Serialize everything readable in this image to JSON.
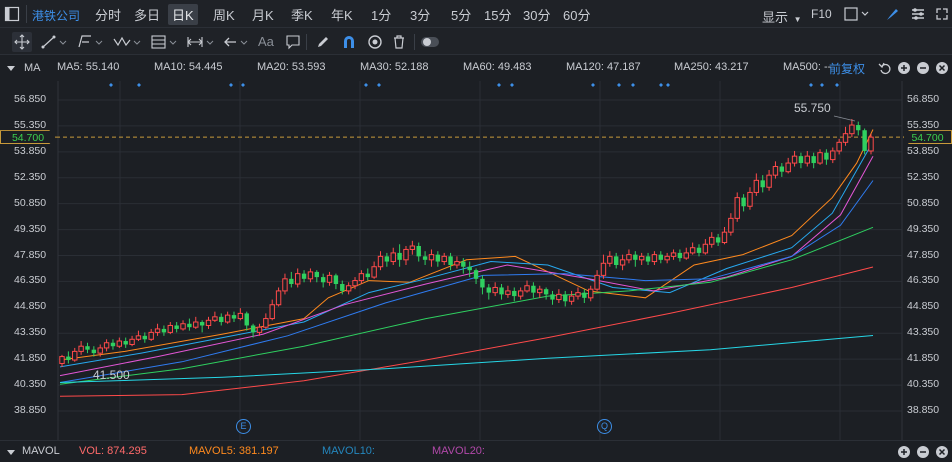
{
  "toolbar": {
    "stock_name": "港铁公司",
    "timeframes": [
      "分时",
      "多日",
      "日K",
      "周K",
      "月K",
      "季K",
      "年K",
      "1分",
      "3分",
      "5分",
      "15分",
      "30分",
      "60分"
    ],
    "active_timeframe": "日K",
    "display_label": "显示",
    "f10_label": "F10"
  },
  "drawing_tools": {
    "icons": [
      "crosshair-icon",
      "line-tool-icon",
      "channel-tool-icon",
      "wave-tool-icon",
      "fib-tool-icon",
      "range-tool-icon",
      "arrow-tool-icon",
      "text-tool-icon",
      "note-tool-icon",
      "pen-icon",
      "magnet-icon",
      "eye-icon",
      "trash-icon",
      "toggle-icon"
    ],
    "text_tool_label": "Aa"
  },
  "ma_bar": {
    "label": "MA",
    "items": [
      {
        "text": "MA5: 55.140",
        "color": "#ff8a1e"
      },
      {
        "text": "MA10: 54.445",
        "color": "#27a9f0"
      },
      {
        "text": "MA20: 53.593",
        "color": "#e356d6"
      },
      {
        "text": "MA30: 52.188",
        "color": "#2f7bf0"
      },
      {
        "text": "MA60: 49.483",
        "color": "#2fd060"
      },
      {
        "text": "MA120: 47.187",
        "color": "#ff4a4a"
      },
      {
        "text": "MA250: 43.217",
        "color": "#26d6e6"
      },
      {
        "text": "MA500: --",
        "color": "#8a7a3a"
      }
    ],
    "adjust_label": "前复权"
  },
  "price_axis": {
    "ticks": [
      "56.850",
      "55.350",
      "53.850",
      "52.350",
      "50.850",
      "49.350",
      "47.850",
      "46.350",
      "44.850",
      "43.350",
      "41.850",
      "40.350",
      "38.850"
    ],
    "current_price": "54.700",
    "high_label": "55.750",
    "low_label": "41.500"
  },
  "markers": {
    "event_e": "E",
    "event_q": "Q"
  },
  "volume_bar": {
    "label": "MAVOL",
    "vol": "VOL: 874.295",
    "mavol5": "MAVOL5: 381.197",
    "mavol10": "MAVOL10:",
    "mavol20": "MAVOL20:"
  },
  "colors": {
    "up": "#ff4a4a",
    "down": "#2fd060",
    "current": "#3ccf4e",
    "accent": "#3d8fe8"
  },
  "chart_data": {
    "type": "candlestick",
    "ylim": [
      38.25,
      57.45
    ],
    "candles": [
      [
        41.6,
        42.0,
        42.1,
        41.4
      ],
      [
        42.0,
        41.8,
        42.3,
        41.6
      ],
      [
        41.8,
        42.3,
        42.5,
        41.7
      ],
      [
        42.3,
        42.6,
        42.9,
        42.1
      ],
      [
        42.6,
        42.4,
        42.8,
        42.2
      ],
      [
        42.4,
        42.2,
        42.6,
        42.0
      ],
      [
        42.2,
        42.5,
        42.7,
        42.0
      ],
      [
        42.5,
        42.8,
        43.0,
        42.3
      ],
      [
        42.8,
        42.6,
        43.0,
        42.4
      ],
      [
        42.6,
        42.9,
        43.1,
        42.5
      ],
      [
        42.9,
        42.7,
        43.1,
        42.5
      ],
      [
        42.7,
        43.0,
        43.2,
        42.6
      ],
      [
        43.0,
        43.2,
        43.5,
        42.9
      ],
      [
        43.2,
        43.0,
        43.4,
        42.8
      ],
      [
        43.0,
        43.4,
        43.6,
        42.9
      ],
      [
        43.4,
        43.6,
        43.9,
        43.2
      ],
      [
        43.6,
        43.4,
        43.8,
        43.2
      ],
      [
        43.4,
        43.8,
        44.0,
        43.3
      ],
      [
        43.8,
        43.6,
        44.0,
        43.4
      ],
      [
        43.6,
        43.9,
        44.1,
        43.5
      ],
      [
        43.9,
        43.7,
        44.2,
        43.5
      ],
      [
        43.7,
        44.0,
        44.3,
        43.6
      ],
      [
        44.0,
        43.8,
        44.1,
        43.4
      ],
      [
        43.8,
        44.1,
        44.3,
        43.6
      ],
      [
        44.1,
        44.3,
        44.6,
        44.0
      ],
      [
        44.3,
        44.0,
        44.5,
        43.8
      ],
      [
        44.0,
        44.4,
        44.6,
        43.9
      ],
      [
        44.4,
        44.2,
        44.6,
        44.0
      ],
      [
        44.2,
        44.5,
        44.8,
        44.1
      ],
      [
        44.5,
        43.8,
        44.6,
        43.5
      ],
      [
        43.8,
        43.4,
        43.9,
        43.1
      ],
      [
        43.4,
        43.7,
        43.9,
        43.2
      ],
      [
        43.7,
        44.2,
        44.5,
        43.6
      ],
      [
        44.2,
        45.0,
        45.3,
        44.1
      ],
      [
        45.0,
        45.8,
        46.0,
        44.9
      ],
      [
        45.8,
        46.5,
        46.8,
        45.6
      ],
      [
        46.5,
        46.2,
        46.9,
        46.0
      ],
      [
        46.2,
        46.8,
        47.1,
        46.0
      ],
      [
        46.8,
        46.5,
        47.0,
        46.3
      ],
      [
        46.5,
        46.9,
        47.1,
        46.3
      ],
      [
        46.9,
        46.6,
        47.0,
        46.3
      ],
      [
        46.6,
        46.3,
        46.8,
        46.0
      ],
      [
        46.3,
        46.7,
        46.9,
        46.1
      ],
      [
        46.7,
        46.2,
        46.8,
        45.9
      ],
      [
        46.2,
        45.8,
        46.4,
        45.6
      ],
      [
        45.8,
        46.1,
        46.3,
        45.6
      ],
      [
        46.1,
        46.4,
        46.6,
        45.9
      ],
      [
        46.4,
        46.8,
        47.0,
        46.2
      ],
      [
        46.8,
        46.6,
        47.1,
        46.4
      ],
      [
        46.6,
        47.2,
        47.5,
        46.5
      ],
      [
        47.2,
        47.8,
        48.1,
        47.0
      ],
      [
        47.8,
        47.5,
        48.0,
        47.2
      ],
      [
        47.5,
        48.0,
        48.3,
        47.3
      ],
      [
        48.0,
        47.6,
        48.5,
        47.2
      ],
      [
        47.6,
        48.2,
        48.4,
        47.3
      ],
      [
        48.2,
        48.4,
        48.7,
        47.9
      ],
      [
        48.4,
        47.8,
        48.6,
        47.5
      ],
      [
        47.8,
        47.6,
        48.1,
        47.3
      ],
      [
        47.6,
        47.9,
        48.2,
        47.2
      ],
      [
        47.9,
        47.5,
        48.1,
        47.2
      ],
      [
        47.5,
        47.8,
        48.0,
        47.3
      ],
      [
        47.8,
        47.3,
        48.0,
        47.0
      ],
      [
        47.3,
        47.5,
        47.8,
        47.1
      ],
      [
        47.5,
        47.2,
        47.7,
        46.8
      ],
      [
        47.2,
        47.0,
        47.5,
        46.6
      ],
      [
        47.0,
        46.5,
        47.1,
        46.2
      ],
      [
        46.5,
        46.0,
        46.7,
        45.6
      ],
      [
        46.0,
        45.7,
        46.2,
        45.3
      ],
      [
        45.7,
        46.0,
        46.3,
        45.5
      ],
      [
        46.0,
        45.6,
        46.2,
        45.3
      ],
      [
        45.6,
        45.8,
        46.1,
        45.4
      ],
      [
        45.8,
        45.5,
        46.0,
        45.2
      ],
      [
        45.5,
        45.8,
        46.0,
        45.3
      ],
      [
        45.8,
        46.1,
        46.4,
        45.7
      ],
      [
        46.1,
        45.7,
        46.3,
        45.4
      ],
      [
        45.7,
        45.9,
        46.1,
        45.4
      ],
      [
        45.9,
        45.6,
        46.0,
        45.3
      ],
      [
        45.6,
        45.3,
        45.8,
        45.0
      ],
      [
        45.3,
        45.6,
        45.9,
        45.1
      ],
      [
        45.6,
        45.2,
        45.8,
        44.9
      ],
      [
        45.2,
        45.5,
        45.8,
        45.0
      ],
      [
        45.5,
        45.7,
        46.0,
        45.3
      ],
      [
        45.7,
        45.4,
        45.9,
        45.1
      ],
      [
        45.4,
        45.9,
        46.1,
        45.2
      ],
      [
        45.9,
        46.7,
        47.0,
        45.8
      ],
      [
        46.7,
        47.4,
        47.9,
        46.5
      ],
      [
        47.4,
        47.8,
        48.1,
        47.2
      ],
      [
        47.8,
        47.3,
        48.0,
        47.1
      ],
      [
        47.3,
        47.6,
        47.9,
        47.0
      ],
      [
        47.6,
        47.9,
        48.2,
        47.4
      ],
      [
        47.9,
        47.6,
        48.1,
        47.2
      ],
      [
        47.6,
        47.8,
        48.0,
        47.3
      ],
      [
        47.8,
        47.5,
        48.0,
        47.3
      ],
      [
        47.5,
        47.9,
        48.1,
        47.3
      ],
      [
        47.9,
        47.6,
        48.1,
        47.4
      ],
      [
        47.6,
        47.8,
        48.0,
        47.4
      ],
      [
        47.8,
        48.0,
        48.2,
        47.6
      ],
      [
        48.0,
        47.7,
        48.2,
        47.5
      ],
      [
        47.7,
        48.0,
        48.3,
        47.6
      ],
      [
        48.0,
        48.3,
        48.6,
        47.9
      ],
      [
        48.3,
        48.0,
        48.5,
        47.8
      ],
      [
        48.0,
        48.5,
        48.8,
        47.9
      ],
      [
        48.5,
        48.9,
        49.2,
        48.3
      ],
      [
        48.9,
        48.6,
        49.1,
        48.4
      ],
      [
        48.6,
        49.2,
        49.5,
        48.5
      ],
      [
        49.2,
        50.0,
        50.3,
        49.0
      ],
      [
        50.0,
        51.2,
        51.5,
        49.8
      ],
      [
        51.2,
        50.7,
        51.4,
        50.4
      ],
      [
        50.7,
        51.5,
        51.8,
        50.5
      ],
      [
        51.5,
        52.2,
        52.6,
        51.3
      ],
      [
        52.2,
        51.8,
        52.5,
        51.5
      ],
      [
        51.8,
        52.5,
        52.8,
        51.6
      ],
      [
        52.5,
        53.0,
        53.3,
        52.3
      ],
      [
        53.0,
        52.7,
        53.2,
        52.4
      ],
      [
        52.7,
        53.2,
        53.5,
        52.6
      ],
      [
        53.2,
        53.6,
        53.9,
        53.0
      ],
      [
        53.6,
        53.2,
        53.8,
        52.9
      ],
      [
        53.2,
        53.6,
        53.9,
        53.0
      ],
      [
        53.6,
        53.2,
        53.8,
        52.9
      ],
      [
        53.2,
        53.8,
        54.0,
        53.1
      ],
      [
        53.8,
        53.4,
        54.0,
        53.1
      ],
      [
        53.4,
        53.9,
        54.1,
        53.2
      ],
      [
        53.9,
        54.4,
        54.6,
        53.7
      ],
      [
        54.4,
        54.9,
        55.3,
        54.2
      ],
      [
        54.9,
        55.4,
        55.75,
        54.7
      ],
      [
        55.4,
        55.1,
        55.6,
        54.8
      ],
      [
        55.1,
        53.9,
        55.2,
        53.7
      ],
      [
        53.9,
        54.7,
        54.9,
        53.7
      ]
    ],
    "series": [
      {
        "name": "MA5",
        "color": "#ff8a1e",
        "values": [
          [
            0,
            41.8
          ],
          [
            0.08,
            42.3
          ],
          [
            0.2,
            43.3
          ],
          [
            0.3,
            44.2
          ],
          [
            0.33,
            45.4
          ],
          [
            0.38,
            46.4
          ],
          [
            0.43,
            46.3
          ],
          [
            0.5,
            47.6
          ],
          [
            0.56,
            47.8
          ],
          [
            0.65,
            45.8
          ],
          [
            0.72,
            45.4
          ],
          [
            0.78,
            47.3
          ],
          [
            0.84,
            47.9
          ],
          [
            0.9,
            49.0
          ],
          [
            0.95,
            51.2
          ],
          [
            0.98,
            53.2
          ],
          [
            1.0,
            55.14
          ]
        ]
      },
      {
        "name": "MA10",
        "color": "#27a9f0",
        "values": [
          [
            0,
            41.4
          ],
          [
            0.1,
            42.2
          ],
          [
            0.2,
            43.1
          ],
          [
            0.3,
            44.0
          ],
          [
            0.38,
            45.7
          ],
          [
            0.45,
            46.5
          ],
          [
            0.53,
            47.5
          ],
          [
            0.6,
            47.3
          ],
          [
            0.68,
            46.0
          ],
          [
            0.75,
            45.7
          ],
          [
            0.82,
            47.1
          ],
          [
            0.9,
            48.3
          ],
          [
            0.95,
            50.3
          ],
          [
            1.0,
            54.445
          ]
        ]
      },
      {
        "name": "MA20",
        "color": "#e356d6",
        "values": [
          [
            0,
            40.9
          ],
          [
            0.12,
            42.0
          ],
          [
            0.25,
            43.3
          ],
          [
            0.35,
            45.0
          ],
          [
            0.45,
            46.2
          ],
          [
            0.55,
            47.3
          ],
          [
            0.65,
            46.5
          ],
          [
            0.73,
            45.8
          ],
          [
            0.82,
            46.6
          ],
          [
            0.9,
            47.8
          ],
          [
            0.96,
            50.2
          ],
          [
            1.0,
            53.593
          ]
        ]
      },
      {
        "name": "MA30",
        "color": "#2f7bf0",
        "values": [
          [
            0,
            40.5
          ],
          [
            0.15,
            41.7
          ],
          [
            0.28,
            43.2
          ],
          [
            0.4,
            45.1
          ],
          [
            0.52,
            46.7
          ],
          [
            0.62,
            46.8
          ],
          [
            0.72,
            46.4
          ],
          [
            0.8,
            46.5
          ],
          [
            0.9,
            47.8
          ],
          [
            0.96,
            49.6
          ],
          [
            1.0,
            52.188
          ]
        ]
      },
      {
        "name": "MA60",
        "color": "#2fd060",
        "values": [
          [
            0,
            40.4
          ],
          [
            0.15,
            41.3
          ],
          [
            0.3,
            42.6
          ],
          [
            0.45,
            44.2
          ],
          [
            0.6,
            45.5
          ],
          [
            0.7,
            45.8
          ],
          [
            0.8,
            46.3
          ],
          [
            0.9,
            47.6
          ],
          [
            1.0,
            49.483
          ]
        ]
      },
      {
        "name": "MA120",
        "color": "#ff4a4a",
        "values": [
          [
            0,
            39.7
          ],
          [
            0.15,
            39.8
          ],
          [
            0.3,
            40.6
          ],
          [
            0.45,
            41.8
          ],
          [
            0.6,
            43.1
          ],
          [
            0.75,
            44.5
          ],
          [
            0.9,
            46.0
          ],
          [
            1.0,
            47.187
          ]
        ]
      },
      {
        "name": "MA250",
        "color": "#26d6e6",
        "values": [
          [
            0,
            40.5
          ],
          [
            0.2,
            40.8
          ],
          [
            0.4,
            41.3
          ],
          [
            0.6,
            41.9
          ],
          [
            0.8,
            42.4
          ],
          [
            1.0,
            43.217
          ]
        ]
      }
    ]
  }
}
